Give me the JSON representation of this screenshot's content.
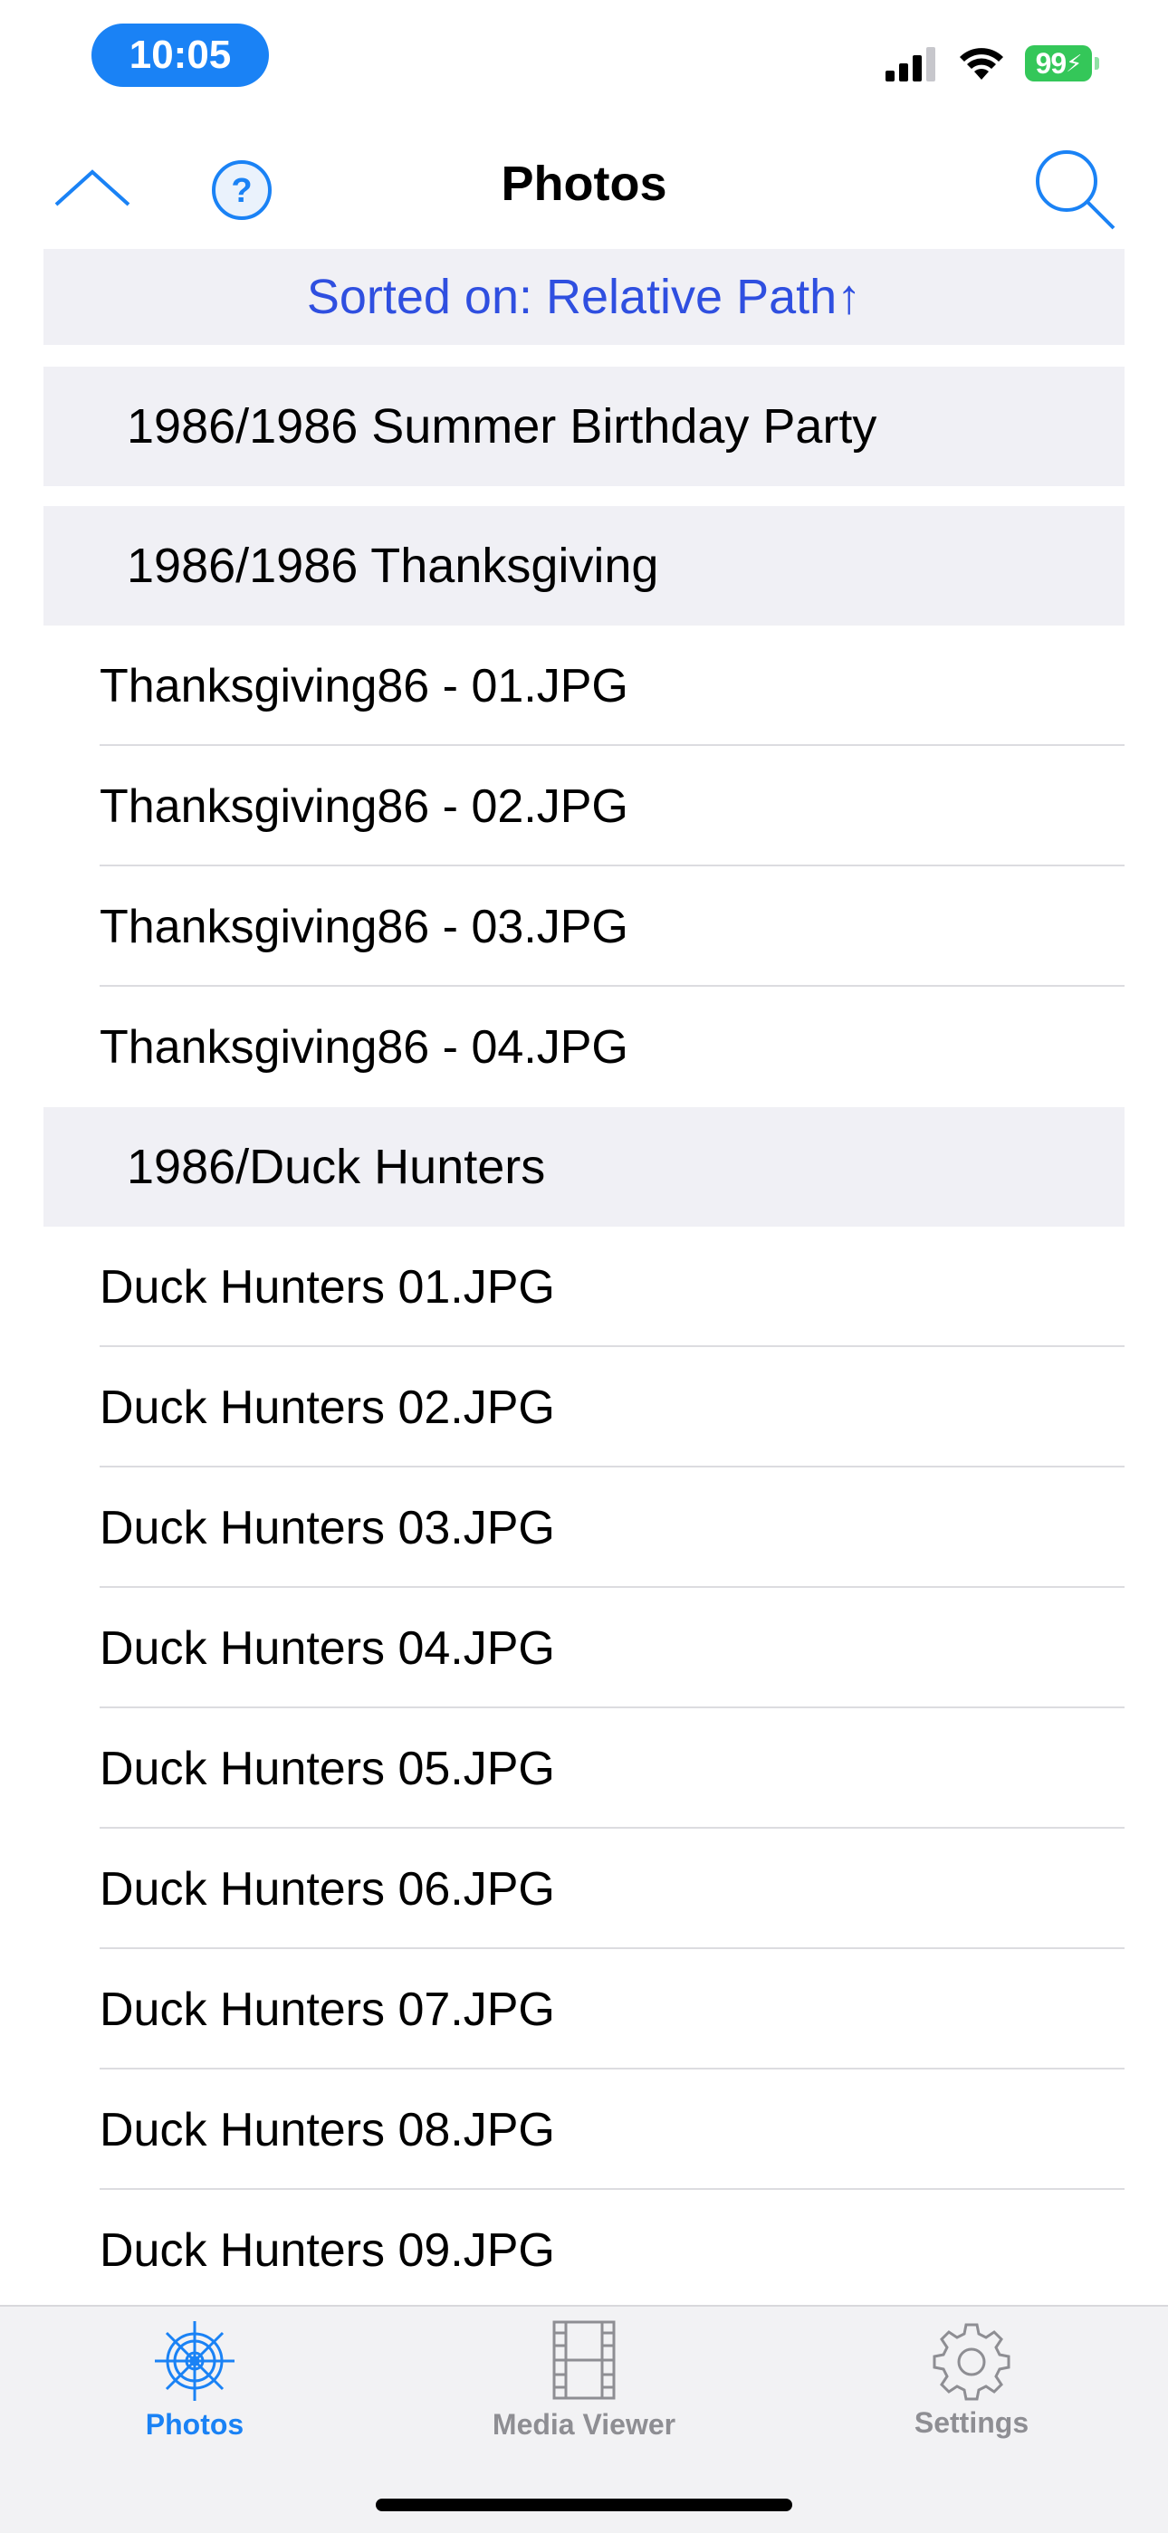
{
  "status_bar": {
    "time": "10:05",
    "battery": "99"
  },
  "nav": {
    "title": "Photos"
  },
  "sort_banner": {
    "text": "Sorted on: Relative Path↑"
  },
  "sections": [
    {
      "title": "1986/1986 Summer Birthday Party",
      "items": []
    },
    {
      "title": "1986/1986 Thanksgiving",
      "items": [
        "Thanksgiving86 - 01.JPG",
        "Thanksgiving86 - 02.JPG",
        "Thanksgiving86 - 03.JPG",
        "Thanksgiving86 - 04.JPG"
      ]
    },
    {
      "title": "1986/Duck Hunters",
      "items": [
        "Duck Hunters 01.JPG",
        "Duck Hunters 02.JPG",
        "Duck Hunters 03.JPG",
        "Duck Hunters 04.JPG",
        "Duck Hunters 05.JPG",
        "Duck Hunters 06.JPG",
        "Duck Hunters 07.JPG",
        "Duck Hunters 08.JPG",
        "Duck Hunters 09.JPG"
      ]
    }
  ],
  "tabs": [
    {
      "label": "Photos",
      "icon": "ship-wheel-icon",
      "active": true
    },
    {
      "label": "Media Viewer",
      "icon": "film-strip-icon",
      "active": false
    },
    {
      "label": "Settings",
      "icon": "gear-icon",
      "active": false
    }
  ],
  "colors": {
    "accent": "#1a82f5",
    "sort_text": "#2f4fe0",
    "inactive": "#8e8e93",
    "header_bg": "#f0f0f5"
  }
}
